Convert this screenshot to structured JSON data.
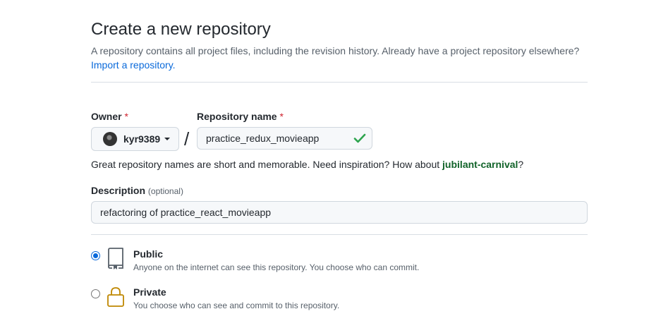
{
  "header": {
    "title": "Create a new repository",
    "subtitle": "A repository contains all project files, including the revision history. Already have a project repository elsewhere?",
    "import_link": "Import a repository."
  },
  "owner": {
    "label": "Owner",
    "required_mark": "*",
    "value": "kyr9389",
    "avatar_icon": "user-avatar"
  },
  "separator": "/",
  "repository_name": {
    "label": "Repository name",
    "required_mark": "*",
    "value": "practice_redux_movieapp",
    "status_icon": "check-icon",
    "status_color": "#2da44e"
  },
  "name_hint": {
    "text": "Great repository names are short and memorable. Need inspiration? How about ",
    "suggestion": "jubilant-carnival",
    "suffix": "?"
  },
  "description": {
    "label": "Description",
    "optional_label": "(optional)",
    "value": "refactoring of practice_react_movieapp"
  },
  "visibility": {
    "selected": "Public",
    "options": [
      {
        "title": "Public",
        "description": "Anyone on the internet can see this repository. You choose who can commit.",
        "icon": "repo-icon",
        "checked": true
      },
      {
        "title": "Private",
        "description": "You choose who can see and commit to this repository.",
        "icon": "lock-icon",
        "checked": false
      }
    ]
  },
  "colors": {
    "link": "#0969da",
    "required": "#cf222e",
    "suggestion": "#116329",
    "radio_accent": "#0969da"
  }
}
